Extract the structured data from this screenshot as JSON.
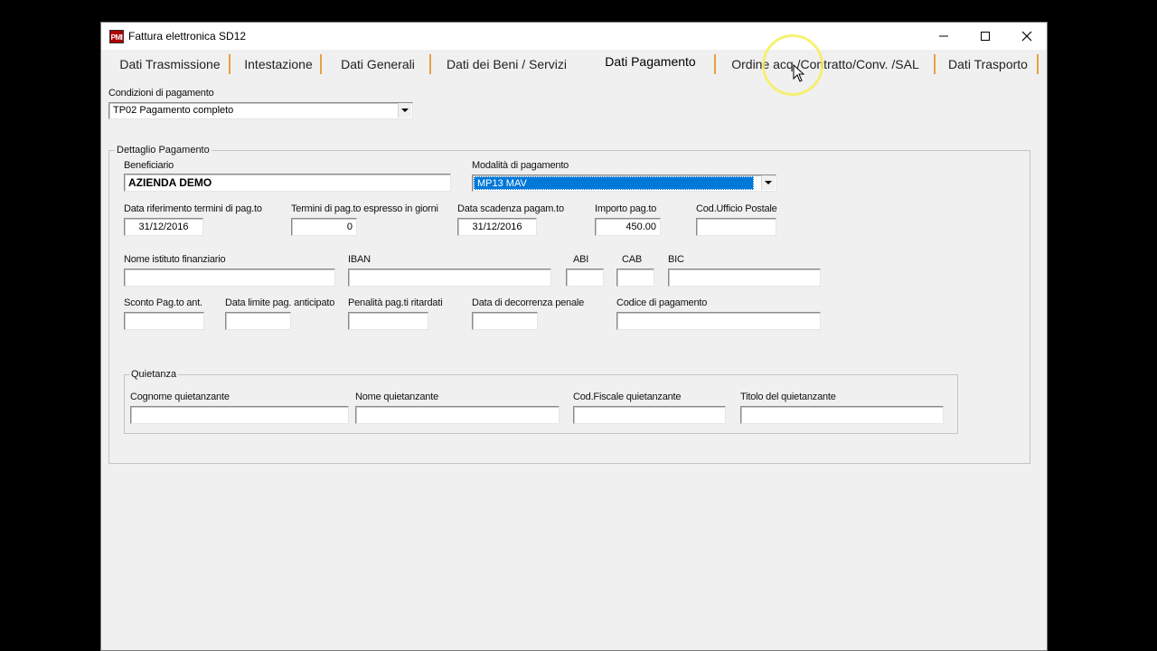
{
  "window": {
    "title": "Fattura elettronica SD12",
    "icon_text": "PMI"
  },
  "tabs": [
    {
      "label": "Dati Trasmissione"
    },
    {
      "label": "Intestazione"
    },
    {
      "label": "Dati Generali"
    },
    {
      "label": "Dati dei Beni / Servizi"
    },
    {
      "label": "Dati Pagamento",
      "active": true
    },
    {
      "label": "Ordine acq./Contratto/Conv. /SAL"
    },
    {
      "label": "Dati Trasporto"
    }
  ],
  "condizioni": {
    "label": "Condizioni di pagamento",
    "value": "TP02 Pagamento completo"
  },
  "dettaglio": {
    "legend": "Dettaglio Pagamento",
    "beneficiario": {
      "label": "Beneficiario",
      "value": "AZIENDA DEMO"
    },
    "modalita": {
      "label": "Modalità di pagamento",
      "value": "MP13 MAV"
    },
    "data_riferimento": {
      "label": "Data riferimento termini di pag.to",
      "value": "31/12/2016"
    },
    "termini": {
      "label": "Termini di pag.to espresso in giorni",
      "value": "0"
    },
    "data_scadenza": {
      "label": "Data scadenza pagam.to",
      "value": "31/12/2016"
    },
    "importo": {
      "label": "Importo pag.to",
      "value": "450.00"
    },
    "cod_ufficio": {
      "label": "Cod.Ufficio Postale",
      "value": ""
    },
    "nome_istituto": {
      "label": "Nome istituto finanziario",
      "value": ""
    },
    "iban": {
      "label": "IBAN",
      "value": ""
    },
    "abi": {
      "label": "ABI",
      "value": ""
    },
    "cab": {
      "label": "CAB",
      "value": ""
    },
    "bic": {
      "label": "BIC",
      "value": ""
    },
    "sconto": {
      "label": "Sconto Pag.to ant.",
      "value": ""
    },
    "data_limite": {
      "label": "Data limite pag. anticipato",
      "value": ""
    },
    "penalita": {
      "label": "Penalità pag.ti ritardati",
      "value": ""
    },
    "data_decorrenza": {
      "label": "Data di decorrenza penale",
      "value": ""
    },
    "codice_pagamento": {
      "label": "Codice di pagamento",
      "value": ""
    }
  },
  "quietanza": {
    "legend": "Quietanza",
    "cognome": {
      "label": "Cognome quietanzante",
      "value": ""
    },
    "nome": {
      "label": "Nome quietanzante",
      "value": ""
    },
    "cod_fiscale": {
      "label": "Cod.Fiscale quietanzante",
      "value": ""
    },
    "titolo": {
      "label": "Titolo del quietanzante",
      "value": ""
    }
  },
  "colors": {
    "selection": "#0078d7",
    "tab_separator": "#e8a040",
    "cursor_highlight": "#f6ee5a"
  }
}
